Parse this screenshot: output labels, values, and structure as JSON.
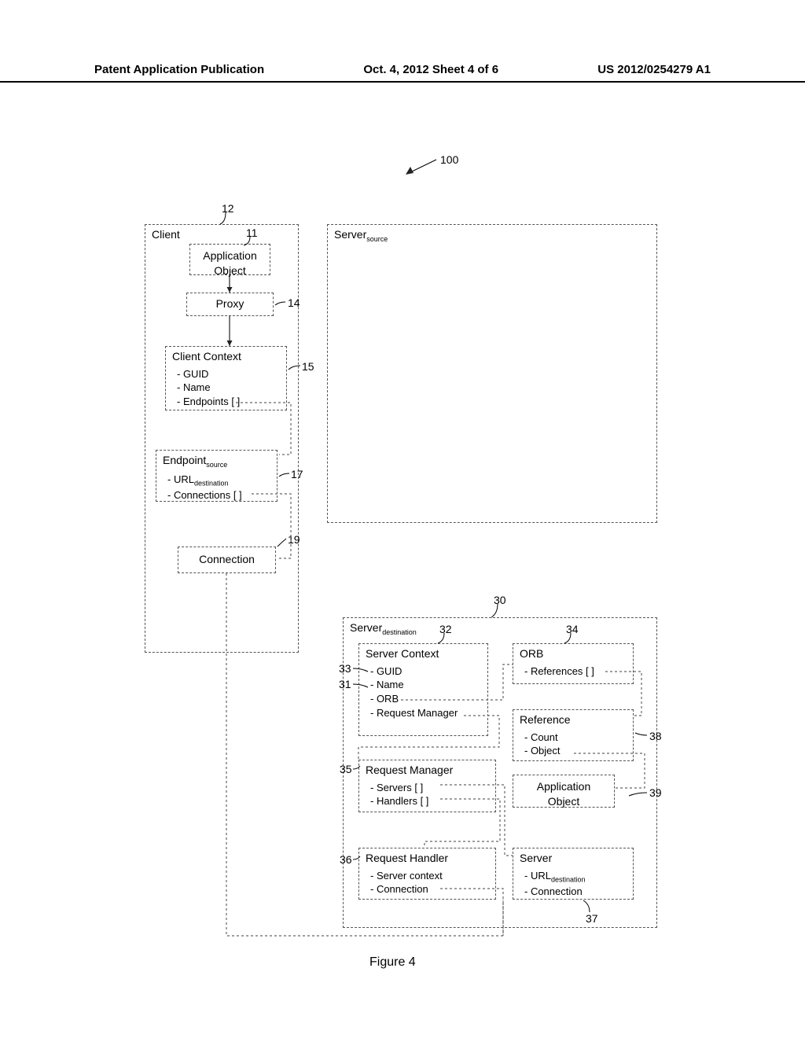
{
  "header": {
    "left": "Patent Application Publication",
    "center": "Oct. 4, 2012  Sheet 4 of 6",
    "right": "US 2012/0254279 A1"
  },
  "figure": {
    "caption": "Figure 4",
    "ref_overall": "100"
  },
  "client": {
    "label": "Client",
    "ref_client": "12",
    "app_object": {
      "label": "Application Object",
      "ref": "11"
    },
    "proxy": {
      "label": "Proxy",
      "ref": "14"
    },
    "context": {
      "title": "Client Context",
      "ref": "15",
      "rows": [
        "- GUID",
        "- Name",
        "- Endpoints [ ]"
      ]
    },
    "endpoint": {
      "title": "Endpoint",
      "title_sub": "source",
      "ref": "17",
      "rows": [
        "- URL",
        "- Connections [ ]"
      ],
      "row0_sub": "destination"
    },
    "connection": {
      "label": "Connection",
      "ref": "19"
    }
  },
  "server_source": {
    "title": "Server",
    "title_sub": "source"
  },
  "server_dest": {
    "title": "Server",
    "title_sub": "destination",
    "ref": "30",
    "context": {
      "title": "Server Context",
      "ref_outer": "32",
      "rows": [
        "- GUID",
        "- Name",
        "- ORB",
        "- Request Manager"
      ],
      "ref_guid": "33",
      "ref_name": "31"
    },
    "orb": {
      "title": "ORB",
      "ref": "34",
      "rows": [
        "- References [ ]"
      ]
    },
    "reference": {
      "title": "Reference",
      "ref": "38",
      "rows": [
        "- Count",
        "- Object"
      ]
    },
    "app_object": {
      "label": "Application Object",
      "ref": "39"
    },
    "req_manager": {
      "title": "Request Manager",
      "ref": "35",
      "rows": [
        "- Servers [ ]",
        "- Handlers [ ]"
      ]
    },
    "req_handler": {
      "title": "Request Handler",
      "ref": "36",
      "rows": [
        "- Server context",
        "- Connection"
      ]
    },
    "server_box": {
      "title": "Server",
      "ref": "37",
      "rows": [
        "- URL",
        "- Connection"
      ],
      "row0_sub": "destination"
    }
  }
}
